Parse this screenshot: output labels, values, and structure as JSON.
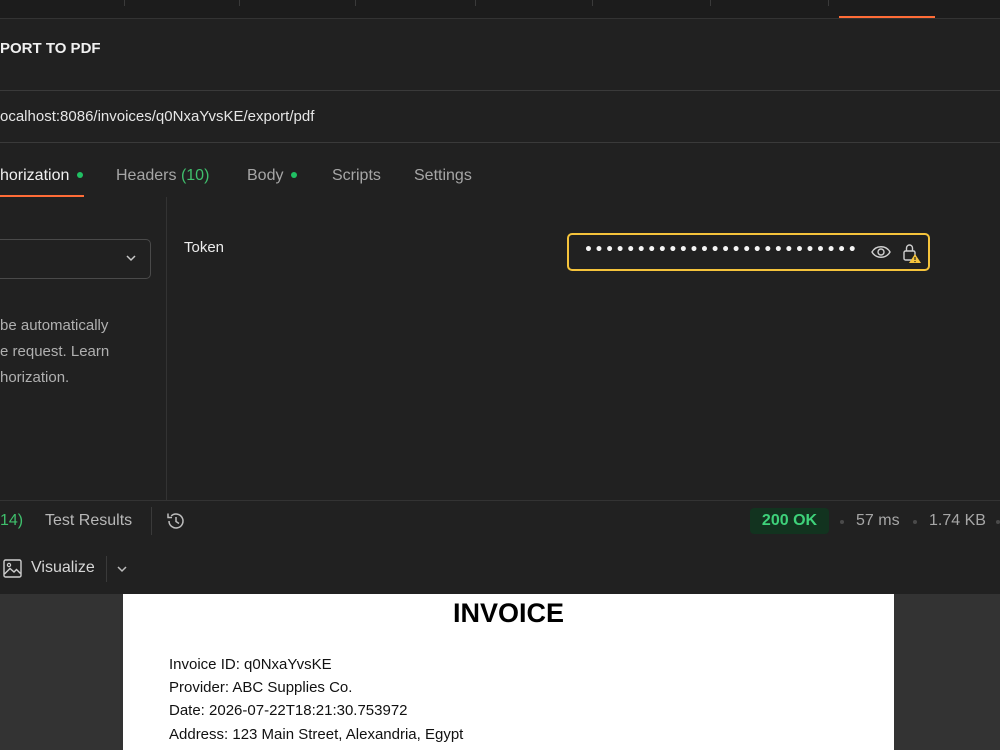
{
  "request": {
    "title": "PORT TO PDF",
    "url": "ocalhost:8086/invoices/q0NxaYvsKE/export/pdf"
  },
  "request_tabs": {
    "authorization": "horization",
    "headers": "Headers",
    "headers_count": "(10)",
    "body": "Body",
    "scripts": "Scripts",
    "settings": "Settings"
  },
  "auth": {
    "description": "be automatically e request. Learn horization.",
    "desc_line1": "be automatically",
    "desc_line2": "e request. Learn",
    "desc_line3": "horization.",
    "token_label": "Token",
    "token_value": "••••••••••••••••••••••••••••••••••"
  },
  "response": {
    "tab_count": "14)",
    "test_results": "Test Results",
    "status": "200 OK",
    "time": "57 ms",
    "size": "1.74 KB",
    "visualize": "Visualize"
  },
  "invoice": {
    "title": "INVOICE",
    "id_line": "Invoice ID: q0NxaYvsKE",
    "provider_line": "Provider: ABC Supplies Co.",
    "date_line": "Date: 2026-07-22T18:21:30.753972",
    "address_line": "Address: 123 Main Street, Alexandria, Egypt"
  },
  "colors": {
    "accent": "#ff6c37",
    "success": "#20c063",
    "warning": "#f5c33b"
  }
}
